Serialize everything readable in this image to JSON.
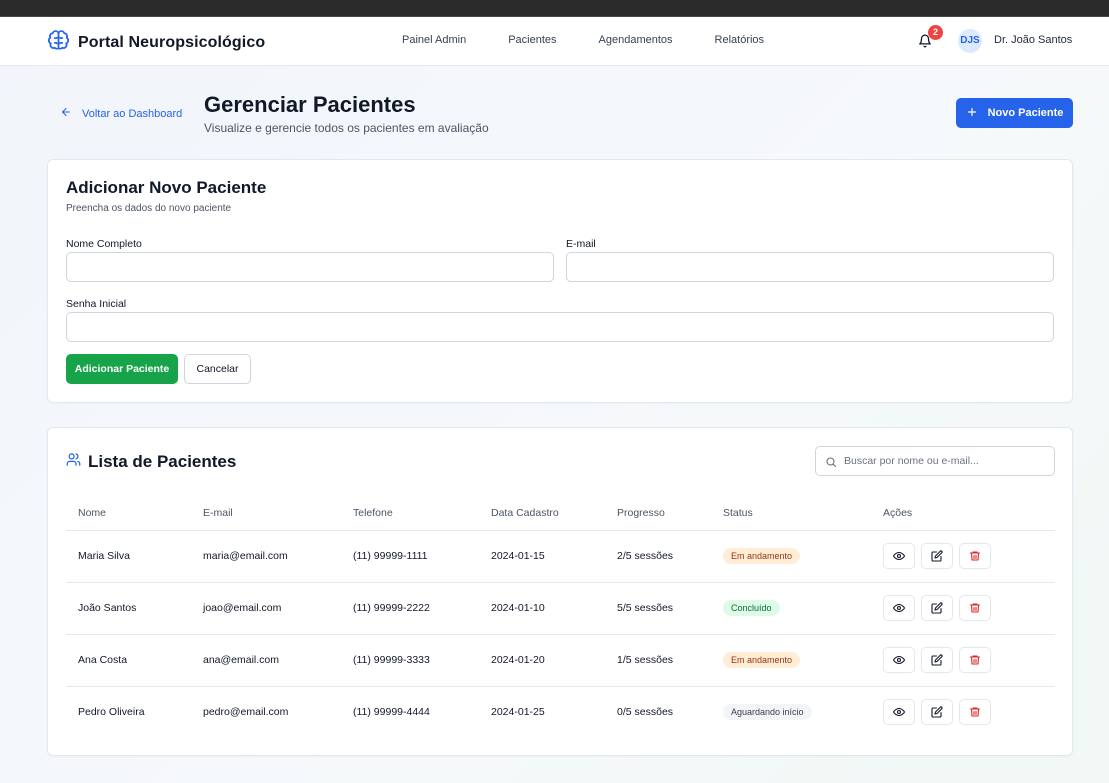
{
  "app": {
    "brand": "Portal Neuropsicológico",
    "nav": [
      "Painel Admin",
      "Pacientes",
      "Agendamentos",
      "Relatórios"
    ],
    "notifications": "2",
    "user_initials": "DJS",
    "user_name": "Dr. João Santos"
  },
  "header": {
    "back_label": "Voltar ao Dashboard",
    "title": "Gerenciar Pacientes",
    "subtitle": "Visualize e gerencie todos os pacientes em avaliação",
    "new_button": "Novo Paciente"
  },
  "add_form": {
    "title": "Adicionar Novo Paciente",
    "subtitle": "Preencha os dados do novo paciente",
    "name_label": "Nome Completo",
    "name_value": "",
    "email_label": "E-mail",
    "email_value": "",
    "password_label": "Senha Inicial",
    "password_value": "",
    "submit_label": "Adicionar Paciente",
    "cancel_label": "Cancelar"
  },
  "list": {
    "title": "Lista de Pacientes",
    "search_placeholder": "Buscar por nome ou e-mail...",
    "columns": [
      "Nome",
      "E-mail",
      "Telefone",
      "Data Cadastro",
      "Progresso",
      "Status",
      "Ações"
    ],
    "rows": [
      {
        "name": "Maria Silva",
        "email": "maria@email.com",
        "phone": "(11) 99999-1111",
        "date": "2024-01-15",
        "progress": "2/5 sessões",
        "status": "Em andamento",
        "status_kind": "andamento"
      },
      {
        "name": "João Santos",
        "email": "joao@email.com",
        "phone": "(11) 99999-2222",
        "date": "2024-01-10",
        "progress": "5/5 sessões",
        "status": "Concluído",
        "status_kind": "concluido"
      },
      {
        "name": "Ana Costa",
        "email": "ana@email.com",
        "phone": "(11) 99999-3333",
        "date": "2024-01-20",
        "progress": "1/5 sessões",
        "status": "Em andamento",
        "status_kind": "andamento"
      },
      {
        "name": "Pedro Oliveira",
        "email": "pedro@email.com",
        "phone": "(11) 99999-4444",
        "date": "2024-01-25",
        "progress": "0/5 sessões",
        "status": "Aguardando início",
        "status_kind": "aguardando"
      }
    ]
  },
  "colors": {
    "primary": "#2563eb",
    "success": "#16a34a",
    "danger": "#dc2626",
    "badge": "#ef4444"
  }
}
